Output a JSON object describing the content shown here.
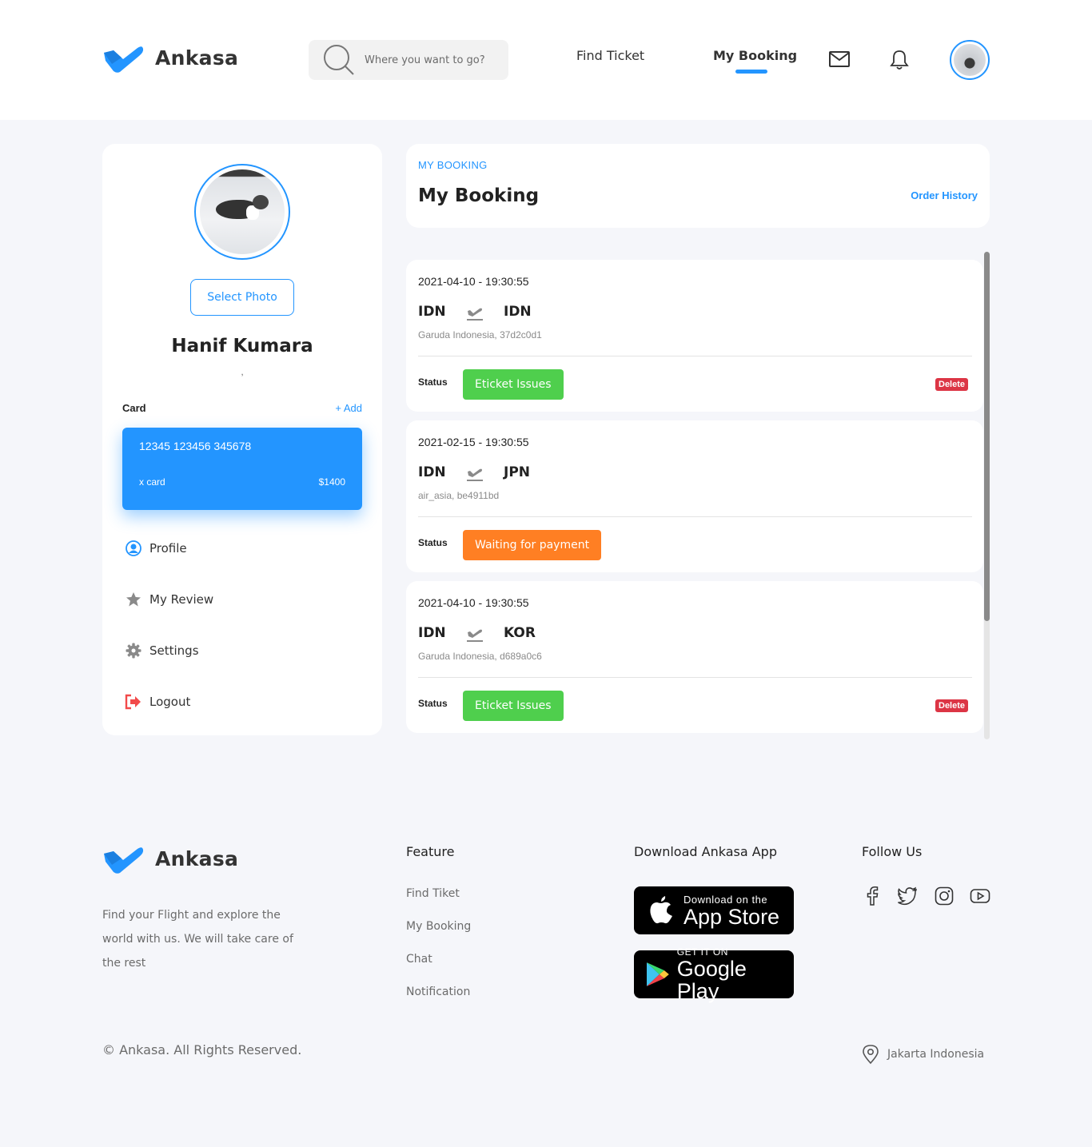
{
  "brand": {
    "name": "Ankasa",
    "accent": "#2395ff"
  },
  "header": {
    "search_placeholder": "Where you want to go?",
    "nav": {
      "find_ticket": "Find Ticket",
      "my_booking": "My Booking"
    },
    "icons": {
      "mail": "mail-icon",
      "bell": "bell-icon"
    }
  },
  "profile": {
    "select_photo": "Select Photo",
    "name": "Hanif Kumara",
    "location": ",",
    "card_label": "Card",
    "card_add": "+ Add",
    "card": {
      "number": "12345 123456 345678",
      "type": "x card",
      "balance": "$1400"
    },
    "menu": [
      {
        "label": "Profile",
        "icon": "profile-icon"
      },
      {
        "label": "My Review",
        "icon": "star-icon"
      },
      {
        "label": "Settings",
        "icon": "gear-icon"
      },
      {
        "label": "Logout",
        "icon": "logout-icon"
      }
    ]
  },
  "booking": {
    "eyebrow": "MY BOOKING",
    "title": "My Booking",
    "order_history": "Order History",
    "status_label": "Status",
    "delete_label": "Delete",
    "items": [
      {
        "datetime": "2021-04-10 - 19:30:55",
        "from": "IDN",
        "to": "IDN",
        "airline": "Garuda Indonesia, 37d2c0d1",
        "status": "Eticket Issues",
        "status_color": "#4fcf4d",
        "deletable": true
      },
      {
        "datetime": "2021-02-15 - 19:30:55",
        "from": "IDN",
        "to": "JPN",
        "airline": "air_asia, be4911bd",
        "status": "Waiting for payment",
        "status_color": "#ff7f23",
        "deletable": false
      },
      {
        "datetime": "2021-04-10 - 19:30:55",
        "from": "IDN",
        "to": "KOR",
        "airline": "Garuda Indonesia, d689a0c6",
        "status": "Eticket Issues",
        "status_color": "#4fcf4d",
        "deletable": true
      }
    ]
  },
  "footer": {
    "description": "Find your Flight and explore the world with us. We will take care of the rest",
    "feature_heading": "Feature",
    "feature_links": [
      "Find Tiket",
      "My Booking",
      "Chat",
      "Notification"
    ],
    "download_heading": "Download Ankasa App",
    "app_store": {
      "line1": "Download on the",
      "line2": "App Store"
    },
    "google_play": {
      "line1": "GET IT ON",
      "line2": "Google Play"
    },
    "follow_heading": "Follow Us",
    "social_icons": [
      "facebook-icon",
      "twitter-icon",
      "instagram-icon",
      "youtube-icon"
    ],
    "copyright": "© Ankasa. All Rights Reserved.",
    "location": "Jakarta Indonesia"
  }
}
